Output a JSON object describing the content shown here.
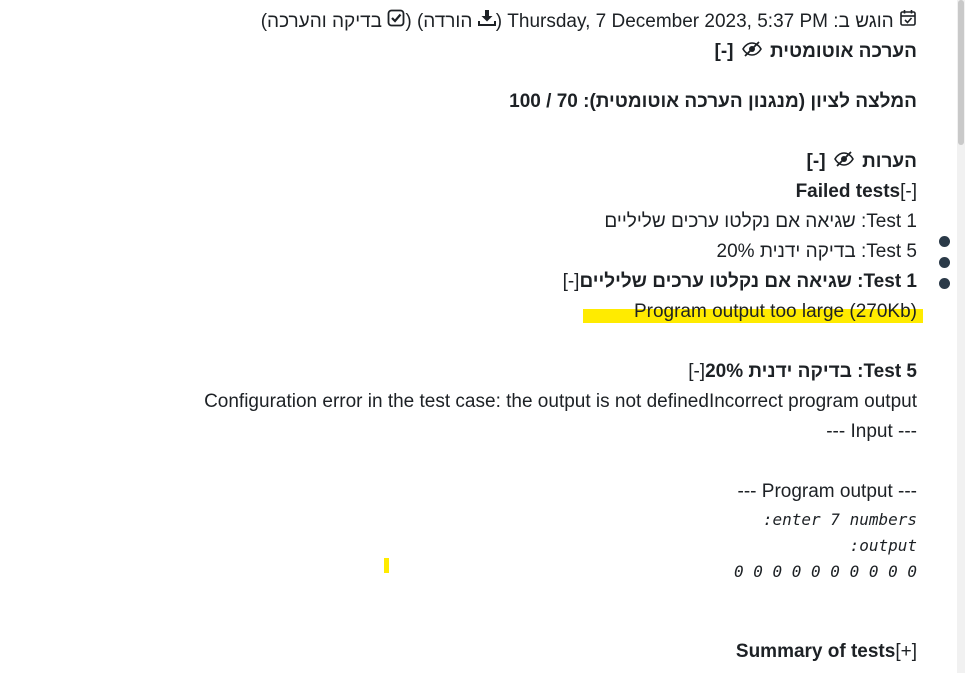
{
  "submission": {
    "submitted_prefix": "הוגש ב:",
    "submitted_date": "Thursday, 7 December 2023, 5:37 PM",
    "download_label": "הורדה",
    "review_label": "בדיקה והערכה"
  },
  "auto_grading": {
    "title": "הערכה אוטומטית",
    "toggle": "[-]",
    "grade_recommendation_label": "המלצה לציון (מנגנון הערכה אוטומטית): 70 / 100"
  },
  "comments": {
    "title": "הערות",
    "toggle": "[-]",
    "failed_tests_label": "Failed tests",
    "failed_tests_toggle": "[-]",
    "failed_list": [
      "Test 1: שגיאה אם נקלטו ערכים שליליים",
      "Test 5: בדיקה ידנית 20%"
    ]
  },
  "test1": {
    "toggle": "[-]",
    "title": "Test 1: שגיאה אם נקלטו ערכים שליליים",
    "message": "Program output too large (270Kb)"
  },
  "test5": {
    "toggle": "[-]",
    "title": "Test 5: בדיקה ידנית 20%",
    "config_error": "Configuration error in the test case: the output is not definedIncorrect program output",
    "input_header": "--- Input ---",
    "program_output_header": "--- Program output ---",
    "output_lines": [
      "enter 7 numbers:",
      "output:",
      "0 0 0 0 0 0 0 0 0 0"
    ]
  },
  "summary": {
    "label": "Summary of tests",
    "toggle": "[+]"
  }
}
